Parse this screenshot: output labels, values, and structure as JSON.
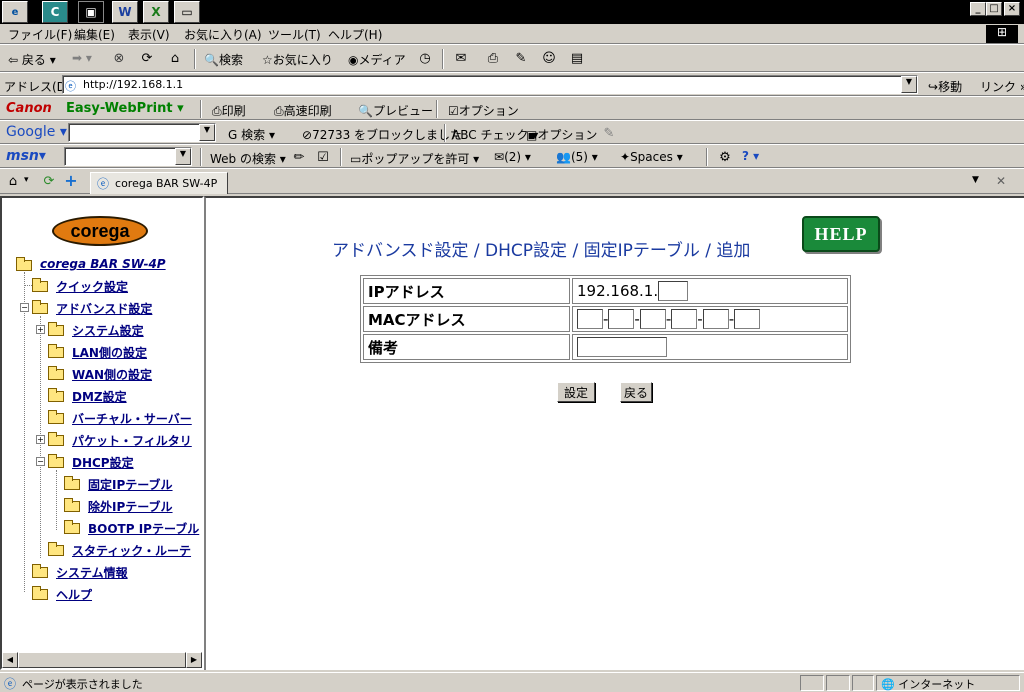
{
  "taskbar": {
    "icons": [
      "C",
      "W",
      "X"
    ]
  },
  "menubar": {
    "items": [
      "ファイル(F)",
      "編集(E)",
      "表示(V)",
      "お気に入り(A)",
      "ツール(T)",
      "ヘルプ(H)"
    ]
  },
  "std_toolbar": {
    "back": "戻る",
    "search": "検索",
    "favorites": "お気に入り",
    "media": "メディア"
  },
  "address": {
    "label": "アドレス(D)",
    "url": "http://192.168.1.1",
    "go": "移動",
    "links": "リンク"
  },
  "canon": {
    "brand": "Canon",
    "product": "Easy-WebPrint",
    "print": "印刷",
    "fast_print": "高速印刷",
    "preview": "プレビュー",
    "options": "オプション"
  },
  "google": {
    "brand": "Google",
    "search": "検索",
    "blocked": "72733 をブロックしました",
    "check": "チェック",
    "options": "オプション"
  },
  "msn": {
    "brand": "msn",
    "web_search": "Web の検索",
    "popup": "ポップアップを許可",
    "mail_count": "(2)",
    "people_count": "(5)",
    "spaces": "Spaces"
  },
  "tabbar": {
    "tab_title": "corega BAR SW-4P",
    "close": "✕"
  },
  "sidebar": {
    "logo": "corega",
    "root": "corega BAR SW-4P",
    "items": [
      "クイック設定",
      "アドバンスド設定",
      "システム設定",
      "LAN側の設定",
      "WAN側の設定",
      "DMZ設定",
      "バーチャル・サーバー",
      "パケット・フィルタリ",
      "DHCP設定",
      "固定IPテーブル",
      "除外IPテーブル",
      "BOOTP IPテーブル",
      "スタティック・ルーテ",
      "システム情報",
      "ヘルプ"
    ]
  },
  "main": {
    "breadcrumb": "アドバンスド設定 / DHCP設定 / 固定IPテーブル / 追加",
    "help": "HELP",
    "ip_label": "IPアドレス",
    "ip_prefix": "192.168.1.",
    "mac_label": "MACアドレス",
    "note_label": "備考",
    "set_button": "設定",
    "back_button": "戻る"
  },
  "statusbar": {
    "text": "ページが表示されました",
    "zone": "インターネット"
  }
}
